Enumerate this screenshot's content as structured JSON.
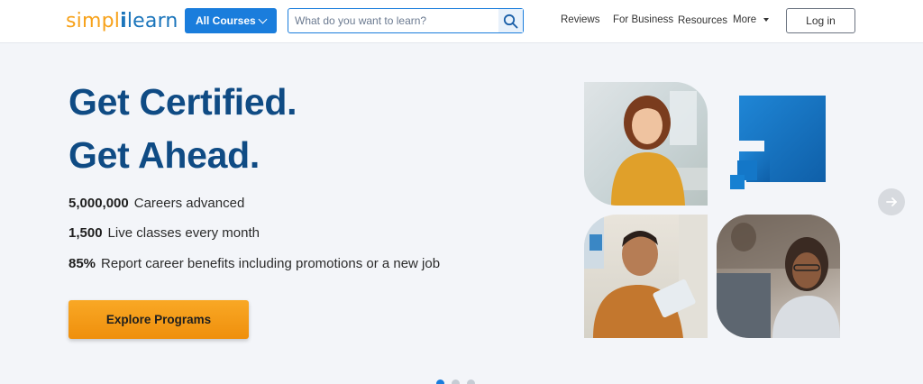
{
  "header": {
    "logo": {
      "part1": "simpl",
      "bar": "i",
      "part2": "learn"
    },
    "all_courses_label": "All Courses",
    "search_placeholder": "What do you want to learn?",
    "nav": [
      "Reviews",
      "For Business",
      "Resources",
      "More"
    ],
    "login_label": "Log in"
  },
  "hero": {
    "headline_line1": "Get Certified.",
    "headline_line2": "Get Ahead.",
    "stats": [
      {
        "value": "5,000,000",
        "label": "Careers advanced"
      },
      {
        "value": "1,500",
        "label": "Live classes every month"
      },
      {
        "value": "85%",
        "label": "Report career benefits including promotions or a new job"
      }
    ],
    "cta_label": "Explore Programs"
  },
  "icons": {
    "search": "search-icon",
    "chevron": "chevron-down-icon",
    "next": "arrow-right-icon"
  },
  "colors": {
    "primary": "#1a7ddc",
    "headline": "#0f4b84",
    "cta": "#f49b13",
    "logo_orange": "#f7a21b",
    "logo_blue": "#1b75bb"
  },
  "carousel": {
    "slides": 3,
    "active": 1
  }
}
